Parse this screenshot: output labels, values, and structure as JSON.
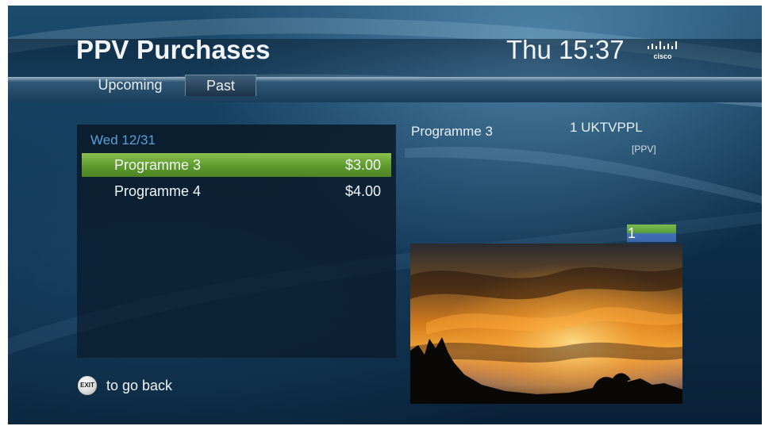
{
  "header": {
    "title": "PPV Purchases",
    "clock": "Thu 15:37",
    "logo": "cisco"
  },
  "tabs": [
    {
      "label": "Upcoming",
      "active": false
    },
    {
      "label": "Past",
      "active": true
    }
  ],
  "purchases": {
    "date": "Wed 12/31",
    "rows": [
      {
        "name": "Programme 3",
        "price": "$3.00",
        "selected": true
      },
      {
        "name": "Programme 4",
        "price": "$4.00",
        "selected": false
      }
    ]
  },
  "details": {
    "title": "Programme 3",
    "channel": "1 UKTVPPL",
    "tag": "[PPV]",
    "channel_number": "1"
  },
  "footer": {
    "exit_key": "EXIT",
    "exit_text": "to go back"
  },
  "colors": {
    "selected_row": "#6aa83a",
    "date_heading": "#5b9fd6",
    "background": "#123a58"
  }
}
